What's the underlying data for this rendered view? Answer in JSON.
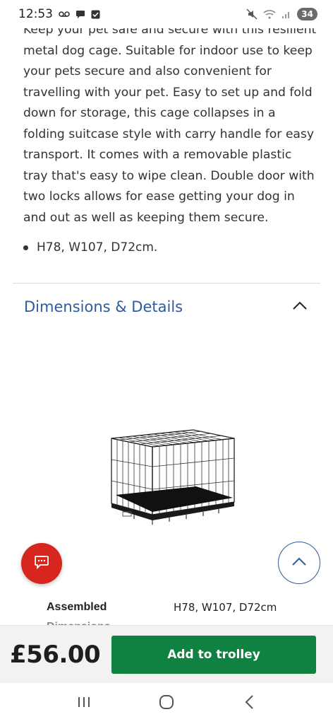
{
  "status_bar": {
    "time": "12:53",
    "battery": "34",
    "icons_left": [
      "voicemail-icon",
      "chat-icon",
      "check-box-icon"
    ],
    "icons_right": [
      "mute-icon",
      "wifi-icon",
      "signal-icon",
      "battery-icon"
    ]
  },
  "description": {
    "text": "Keep your pet safe and secure with this resilient metal dog cage. Suitable for indoor use to keep your pets secure and also convenient for travelling with your pet. Easy to set up and fold down for storage, this cage collapses in a folding suitcase style with carry handle for easy transport. It comes with a removable plastic tray that's easy to wipe clean. Double door with two locks allows for ease getting your dog in and out as well as keeping them secure.",
    "bullets": [
      "H78, W107, D72cm."
    ]
  },
  "accordion": {
    "title": "Dimensions & Details",
    "expanded": true
  },
  "specs": {
    "assembled_label": "Assembled",
    "assembled_value": "H78, W107, D72cm",
    "next_label": "Dimensions"
  },
  "purchase": {
    "price": "£56.00",
    "add_label": "Add to trolley"
  },
  "colors": {
    "accent_blue": "#2e5c9a",
    "brand_red": "#d7261e",
    "button_green": "#0f8242"
  }
}
